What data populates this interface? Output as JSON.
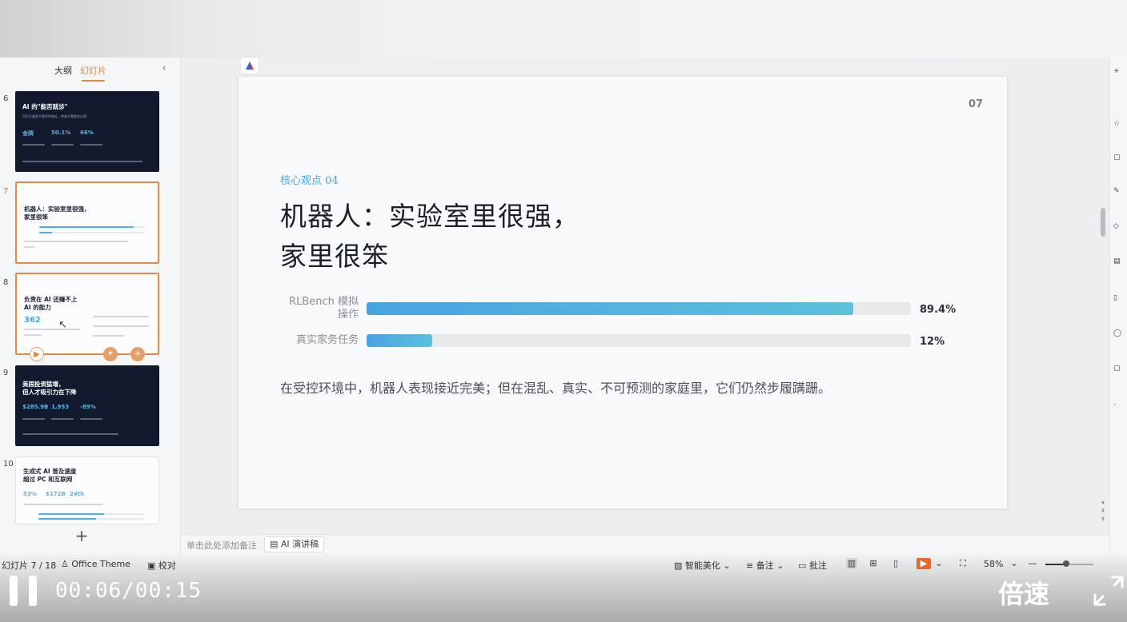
{
  "panel": {
    "tab_outline": "大纲",
    "tab_slides": "幻灯片"
  },
  "thumbs": {
    "t6": {
      "num": "6",
      "title": "AI 的\"能否就诊\"",
      "sub": "它们不要的不要任何地址，转变不需要的计划",
      "stats": [
        "金牌",
        "50.1%",
        "66%"
      ]
    },
    "t7": {
      "num": "7",
      "title_line1": "机器人：实验室里很强，",
      "title_line2": "家里很笨"
    },
    "t8": {
      "num": "8",
      "title_line1": "负责在 AI 还赚不上",
      "title_line2": "AI 的能力",
      "big": "362"
    },
    "t9": {
      "num": "9",
      "title_line1": "美国投资猛增，",
      "title_line2": "但人才吸引力在下降",
      "stats": [
        "$285.9B",
        "1,953",
        "-89%"
      ]
    },
    "t10": {
      "num": "10",
      "title_line1": "生成式 AI 普及速度",
      "title_line2": "超过 PC 和互联网",
      "stats": [
        "53%",
        "$172B",
        "24th"
      ]
    }
  },
  "slide": {
    "page_number": "07",
    "kicker": "核心观点 04",
    "title_line1": "机器人：实验室里很强，",
    "title_line2": "家里很笨",
    "bars": [
      {
        "label_line1": "RLBench 模拟",
        "label_line2": "操作",
        "value_text": "89.4%",
        "value": 89.4
      },
      {
        "label_line1": "真实家务任务",
        "label_line2": "",
        "value_text": "12%",
        "value": 12
      }
    ],
    "body": "在受控环境中，机器人表现接近完美；但在混乱、真实、不可预测的家庭里，它们仍然步履蹒跚。"
  },
  "notes": {
    "placeholder": "单击此处添加备注",
    "ai_script": "AI 演讲稿"
  },
  "status": {
    "slide_count": "幻灯片 7 / 18",
    "theme": "Office Theme",
    "proof": "校对",
    "smart": "智能美化",
    "notes": "备注",
    "comment": "批注",
    "zoom": "58%"
  },
  "player": {
    "time": "00:06/00:15",
    "speed": "倍速"
  },
  "colors": {
    "accent": "#46a6dc",
    "selection": "#e08b4a",
    "dark_slide": "#131a2e"
  }
}
